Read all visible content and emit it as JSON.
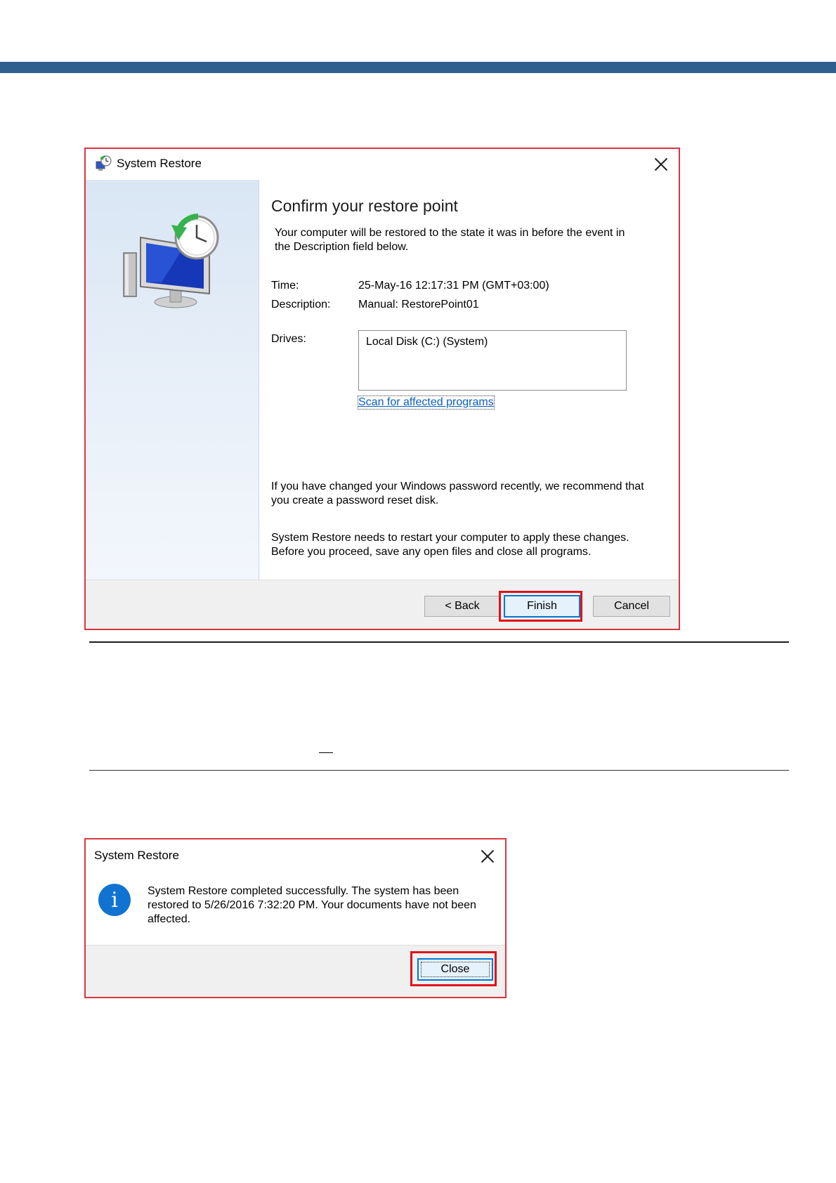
{
  "colors": {
    "top_band": "#2f5f8e",
    "highlight": "#e0131a",
    "link": "#0a5fc4",
    "default_button_border": "#0078d7",
    "info_icon": "#1173d1"
  },
  "confirm_dialog": {
    "title": "System Restore",
    "heading": "Confirm your restore point",
    "intro": "Your computer will be restored to the state it was in before the event in the Description field below.",
    "time_label": "Time:",
    "time_value": "25-May-16 12:17:31 PM (GMT+03:00)",
    "description_label": "Description:",
    "description_value": "Manual: RestorePoint01",
    "drives_label": "Drives:",
    "drives_list": [
      "Local Disk (C:) (System)"
    ],
    "scan_link": "Scan for affected programs",
    "password_note": "If you have changed your Windows password recently, we recommend that you create a password reset disk.",
    "restart_note": "System Restore needs to restart your computer to apply these changes. Before you proceed, save any open files and close all programs.",
    "buttons": {
      "back": "< Back",
      "finish": "Finish",
      "cancel": "Cancel"
    },
    "icons": {
      "title": "system-restore-icon",
      "side": "restore-monitor-clock-icon",
      "close": "close-icon"
    }
  },
  "completion_dialog": {
    "title": "System Restore",
    "message": "System Restore completed successfully. The system has been restored to 5/26/2016 7:32:20 PM. Your documents have not been affected.",
    "buttons": {
      "close": "Close"
    },
    "icons": {
      "info": "info-icon",
      "close": "close-icon"
    }
  }
}
